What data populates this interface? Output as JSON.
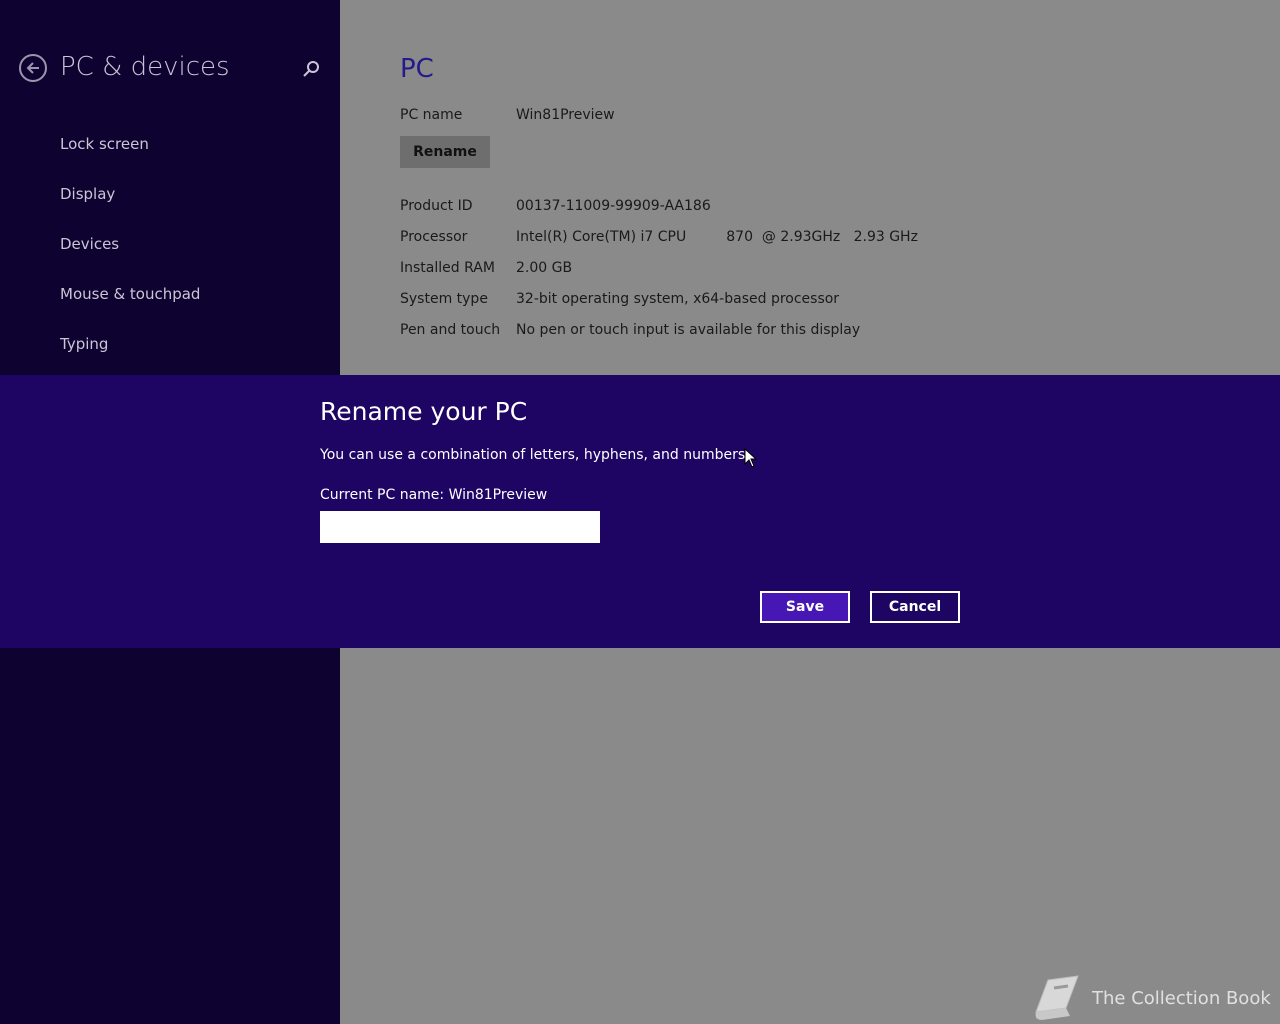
{
  "sidebar": {
    "title": "PC & devices",
    "back_icon": "back-arrow-icon",
    "search_icon": "search-icon",
    "items": [
      {
        "label": "Lock screen"
      },
      {
        "label": "Display"
      },
      {
        "label": "Devices"
      },
      {
        "label": "Mouse & touchpad"
      },
      {
        "label": "Typing"
      }
    ]
  },
  "main": {
    "title": "PC",
    "pc_name_label": "PC name",
    "pc_name_value": "Win81Preview",
    "rename_label": "Rename",
    "info": [
      {
        "label": "Product ID",
        "value": "00137-11009-99909-AA186"
      },
      {
        "label": "Processor",
        "value": "Intel(R) Core(TM) i7 CPU         870  @ 2.93GHz   2.93 GHz"
      },
      {
        "label": "Installed RAM",
        "value": "2.00 GB"
      },
      {
        "label": "System type",
        "value": "32-bit operating system, x64-based processor"
      },
      {
        "label": "Pen and touch",
        "value": "No pen or touch input is available for this display"
      }
    ]
  },
  "dialog": {
    "title": "Rename your PC",
    "description": "You can use a combination of letters, hyphens, and numbers.",
    "field_label": "Current PC name: Win81Preview",
    "input_value": "",
    "save_label": "Save",
    "cancel_label": "Cancel"
  },
  "watermark": {
    "text": "The Collection Book",
    "icon": "book-icon"
  },
  "colors": {
    "sidebar_bg": "#0e0330",
    "dialog_bg": "#1e0563",
    "accent": "#4617b4",
    "content_bg": "#8a8a8a",
    "title_color": "#241a8a"
  }
}
